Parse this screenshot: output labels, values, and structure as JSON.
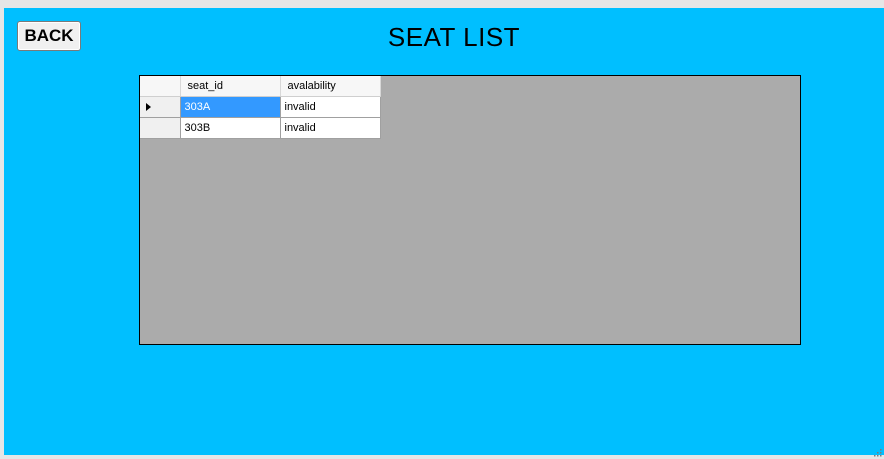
{
  "toolbar": {
    "back_label": "BACK"
  },
  "page": {
    "title": "SEAT LIST"
  },
  "grid": {
    "columns": [
      "seat_id",
      "avalability"
    ],
    "rows": [
      {
        "seat_id": "303A",
        "availability": "invalid",
        "current": true,
        "selected_cell": "seat_id"
      },
      {
        "seat_id": "303B",
        "availability": "invalid",
        "current": false,
        "selected_cell": null
      }
    ]
  },
  "colors": {
    "form_background": "#00bfff",
    "grid_background": "#ababab",
    "selection": "#3399ff"
  }
}
